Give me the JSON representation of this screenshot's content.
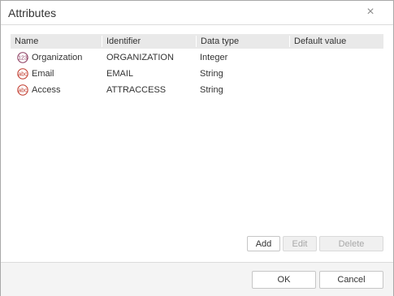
{
  "dialog": {
    "title": "Attributes",
    "close_label": "×"
  },
  "columns": [
    {
      "label": "Name"
    },
    {
      "label": "Identifier"
    },
    {
      "label": "Data type"
    },
    {
      "label": "Default value"
    }
  ],
  "rows": [
    {
      "icon_text": "123",
      "icon": "integer-type-icon",
      "name": "Organization",
      "identifier": "ORGANIZATION",
      "data_type": "Integer",
      "default_value": ""
    },
    {
      "icon_text": "abc",
      "icon": "string-type-icon",
      "name": "Email",
      "identifier": "EMAIL",
      "data_type": "String",
      "default_value": ""
    },
    {
      "icon_text": "abc",
      "icon": "string-type-icon",
      "name": "Access",
      "identifier": "ATTRACCESS",
      "data_type": "String",
      "default_value": ""
    }
  ],
  "actions": {
    "add": "Add",
    "edit": "Edit",
    "delete": "Delete"
  },
  "footer": {
    "ok": "OK",
    "cancel": "Cancel"
  },
  "colors": {
    "icon_integer": "#8b3a5e",
    "icon_string": "#c0392b",
    "header_bg": "#e9e9e9"
  }
}
